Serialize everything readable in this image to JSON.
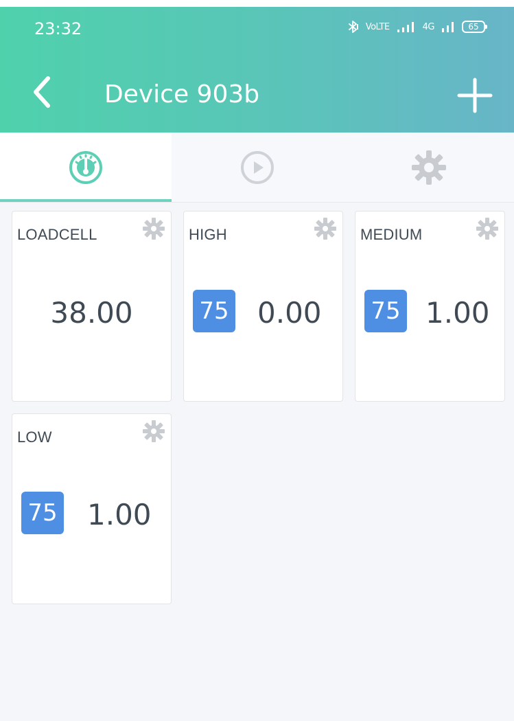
{
  "status": {
    "time": "23:32",
    "bluetooth_icon": "bluetooth-icon",
    "volte_text": "VoLTE",
    "signal_icon": "signal-bars-icon",
    "network_text": "4G",
    "battery_level": "65"
  },
  "header": {
    "title": "Device 903b",
    "back_icon": "chevron-left-icon",
    "add_icon": "plus-icon"
  },
  "tabs": [
    {
      "icon": "dashboard-gauge-icon",
      "active": true
    },
    {
      "icon": "play-circle-icon",
      "active": false
    },
    {
      "icon": "gear-icon",
      "active": false
    }
  ],
  "widgets": [
    {
      "label": "LOADCELL",
      "value": "38.00"
    },
    {
      "label": "HIGH",
      "badge": "75",
      "value": "0.00"
    },
    {
      "label": "MEDIUM",
      "badge": "75",
      "value": "1.00"
    },
    {
      "label": "LOW",
      "badge": "75",
      "value": "1.00"
    }
  ],
  "colors": {
    "header_gradient_start": "#4fd1ac",
    "header_gradient_end": "#68b5c8",
    "accent": "#6ed2bf",
    "badge_blue": "#4e8fe3",
    "gear_gray": "#c8cbd0",
    "text_dark": "#3f4a55",
    "background": "#f5f6f9"
  }
}
